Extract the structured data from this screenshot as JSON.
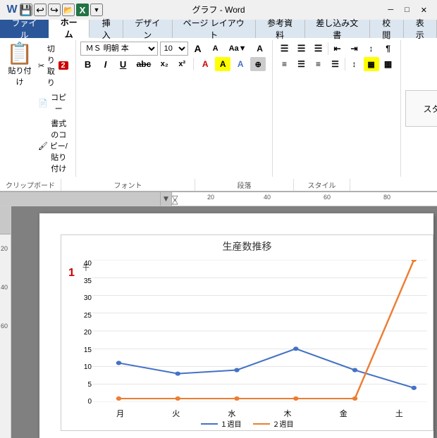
{
  "titlebar": {
    "title": "グラフ - Word",
    "app_name": "Word"
  },
  "quickaccess": {
    "save_label": "💾",
    "undo_label": "↩",
    "redo_label": "↪",
    "open_label": "📂",
    "excel_label": "X",
    "more_label": "▼"
  },
  "tabs": {
    "file": "ファイル",
    "home": "ホーム",
    "insert": "挿入",
    "design": "デザイン",
    "page_layout": "ページ レイアウト",
    "references": "参考資料",
    "mailings": "差し込み文書",
    "review": "校閲",
    "view": "表示"
  },
  "clipboard": {
    "paste_label": "貼り付け",
    "cut_label": "切り取り",
    "copy_label": "コピー",
    "format_painter_label": "書式のコピー/貼り付け",
    "group_label": "クリップボード",
    "annotation": "2"
  },
  "font": {
    "family": "ＭＳ 明朝 本",
    "size": "10",
    "grow_label": "A",
    "shrink_label": "A",
    "case_label": "Aa",
    "clear_label": "A",
    "group_label": "フォント",
    "bold": "B",
    "italic": "I",
    "underline": "U",
    "strikethrough": "abc",
    "subscript": "x₂",
    "superscript": "x²",
    "font_color": "A",
    "highlight": "A",
    "text_effects": "A"
  },
  "paragraph": {
    "group_label": "段落"
  },
  "styles": {
    "group_label": "スタイル"
  },
  "ruler": {
    "ticks": [
      "20",
      "40",
      "60",
      "80"
    ],
    "arrow_label": "▼"
  },
  "left_ruler": {
    "ticks": [
      "20",
      "40",
      "60"
    ]
  },
  "chart": {
    "title": "生産数推移",
    "y_unit": "千",
    "y_ticks": [
      "0",
      "5",
      "10",
      "15",
      "20",
      "25",
      "30",
      "35",
      "40"
    ],
    "x_ticks": [
      "月",
      "火",
      "水",
      "木",
      "金",
      "土"
    ],
    "series1": {
      "label": "１週目",
      "color": "#4472C4",
      "data": [
        11,
        8,
        9,
        15,
        9,
        4
      ]
    },
    "series2": {
      "label": "２週目",
      "color": "#ED7D31",
      "data": [
        1,
        1,
        1,
        1,
        1,
        42
      ]
    }
  },
  "annotations": {
    "chart_num": "1",
    "clipboard_num": "2"
  }
}
